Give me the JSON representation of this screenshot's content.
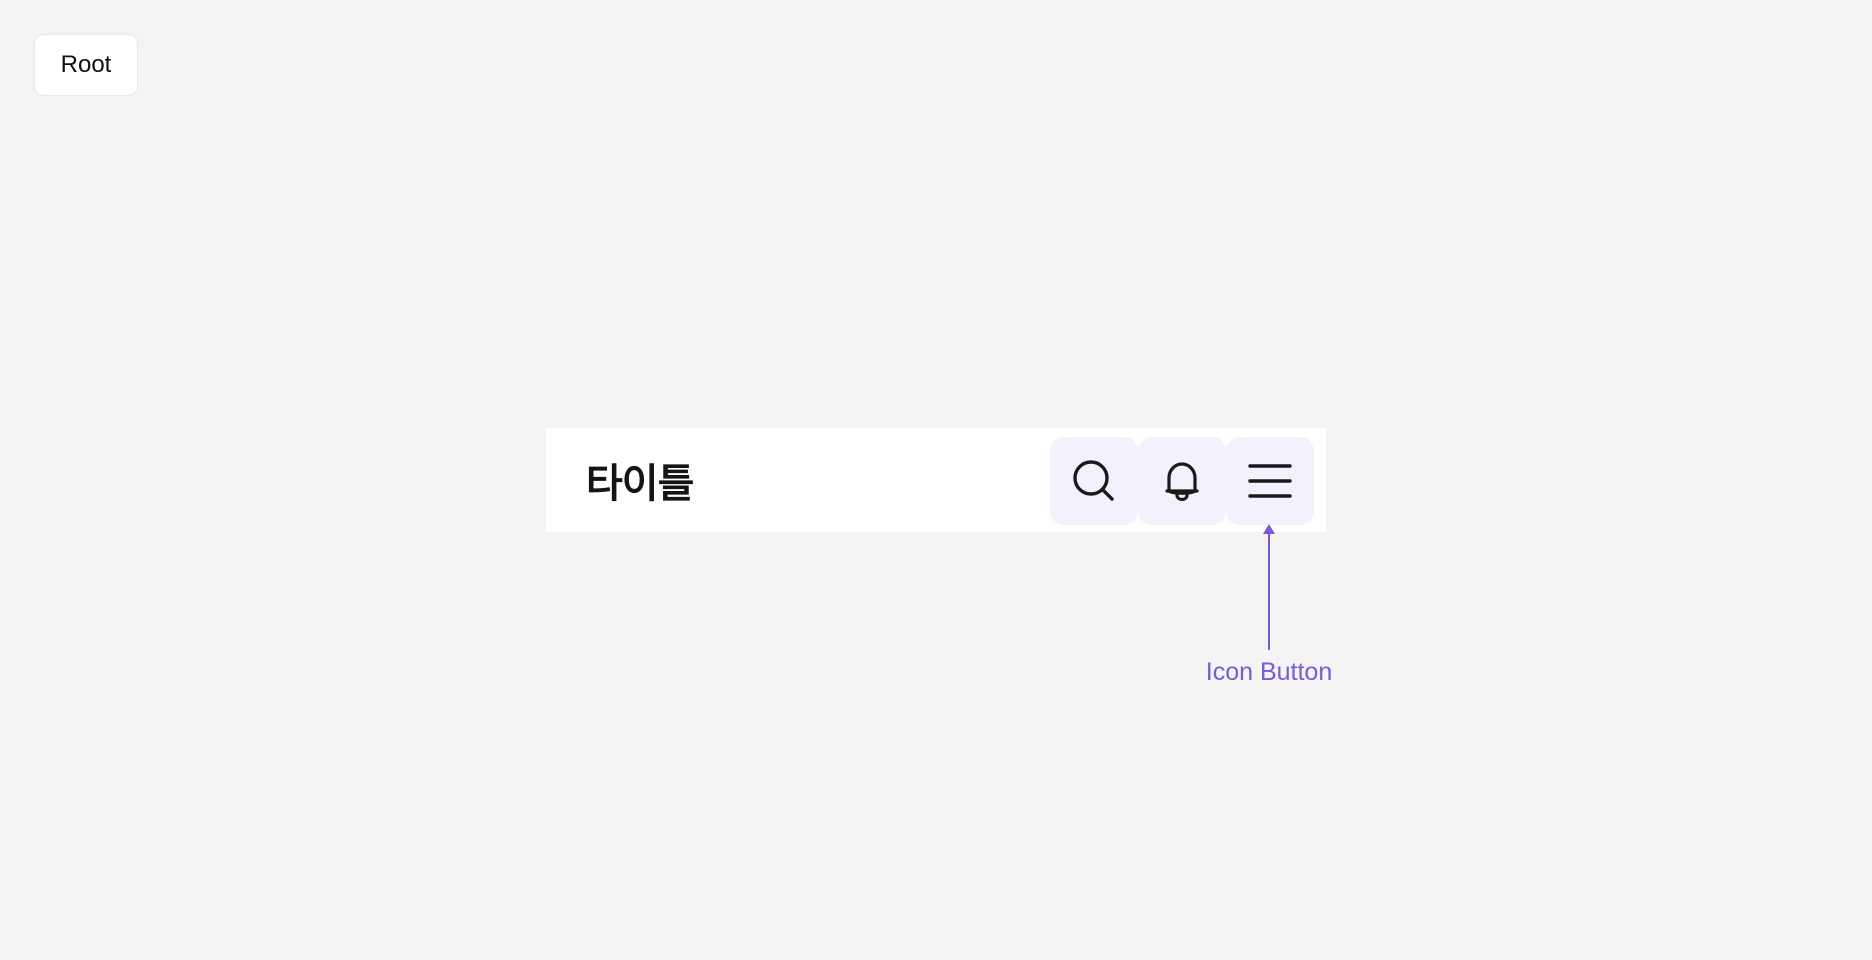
{
  "root_chip": {
    "label": "Root"
  },
  "app_bar": {
    "title": "타이틀",
    "actions": [
      {
        "icon": "search-icon"
      },
      {
        "icon": "bell-icon"
      },
      {
        "icon": "menu-icon"
      }
    ]
  },
  "annotation": {
    "label": "Icon Button",
    "color": "#7b59d8"
  },
  "colors": {
    "background": "#f4f4f4",
    "surface": "#ffffff",
    "icon_button_bg": "#f4f1fc",
    "icon_stroke": "#1a1a1a",
    "accent": "#7b59d8"
  }
}
